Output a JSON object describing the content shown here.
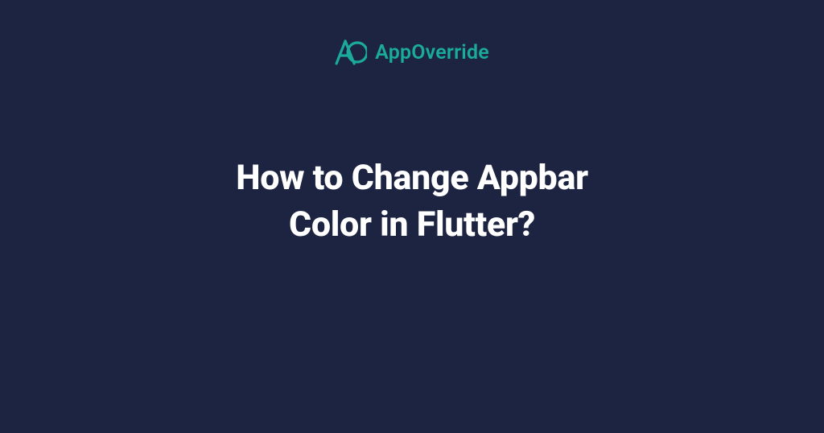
{
  "brand": {
    "name": "AppOverride",
    "accent_color": "#1aab9b"
  },
  "title": "How to Change Appbar\nColor in Flutter?",
  "background_color": "#1d2442"
}
